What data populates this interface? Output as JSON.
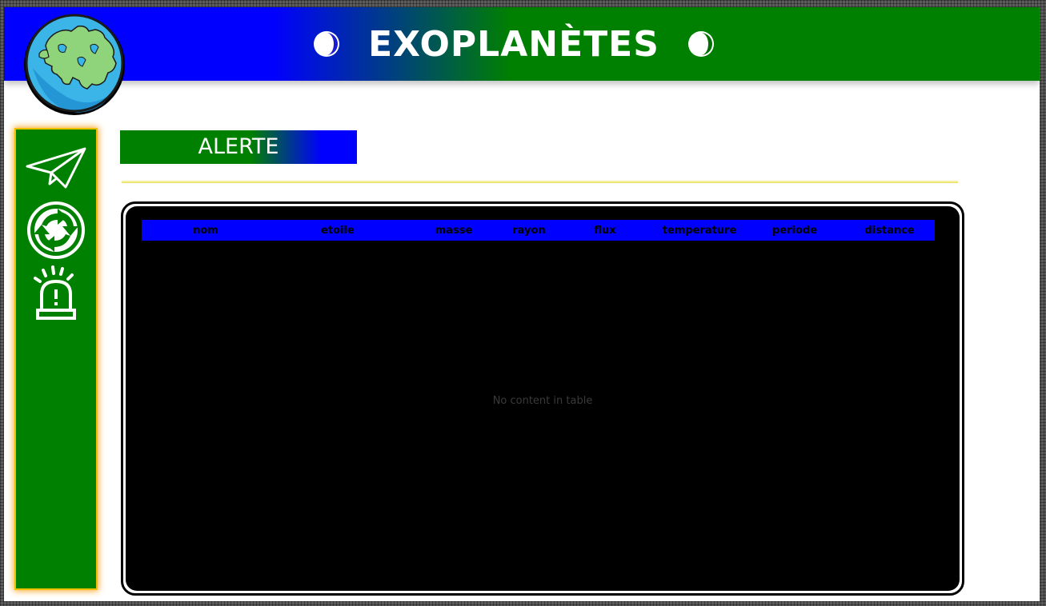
{
  "header": {
    "title": "EXOPLANÈTES",
    "left_icon": "half-moon-icon",
    "right_icon": "half-moon-icon",
    "gradient_colors": [
      "#0000ff",
      "#008000"
    ]
  },
  "logo": {
    "icon": "globe-europe-icon"
  },
  "sidebar": {
    "background_color": "#008000",
    "border_color": "#f5a623",
    "items": [
      {
        "icon": "paper-plane-icon"
      },
      {
        "icon": "refresh-cycle-icon"
      },
      {
        "icon": "alarm-siren-icon"
      }
    ]
  },
  "section": {
    "title": "ALERTE"
  },
  "table": {
    "header_color": "#0000ff",
    "columns": [
      "nom",
      "etoile",
      "masse",
      "rayon",
      "flux",
      "temperature",
      "periode",
      "distance"
    ],
    "rows": [],
    "empty_message": "No content in table"
  }
}
